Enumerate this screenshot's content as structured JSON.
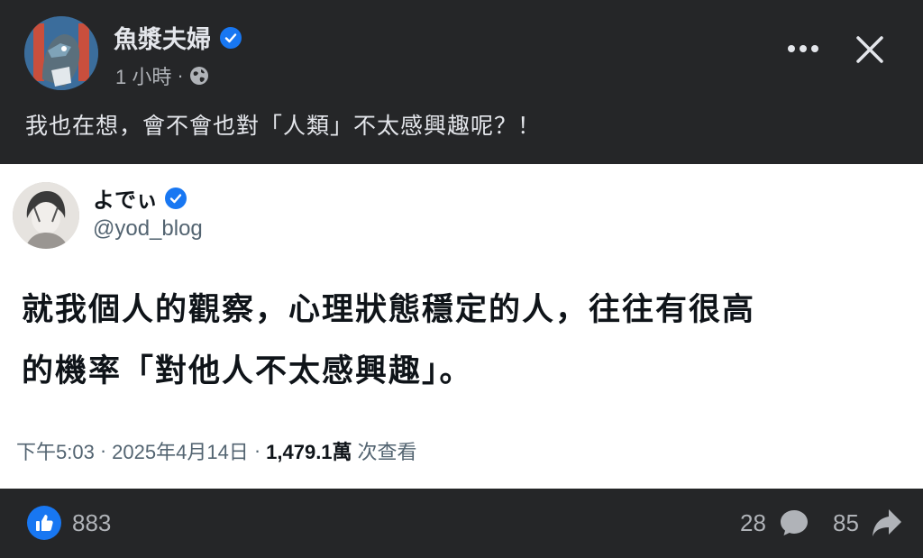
{
  "post": {
    "author": "魚漿夫婦",
    "time": "1 小時",
    "separator": "·",
    "text": "我也在想，會不會也對「人類」不太感興趣呢？！"
  },
  "tweet": {
    "name": "よでぃ",
    "handle": "@yod_blog",
    "body_line1": "就我個人的觀察，心理狀態穩定的人，往往有很高",
    "body_line2": "的機率「對他人不太感興趣」。",
    "time": "下午5:03",
    "dot1": "·",
    "date": "2025年4月14日",
    "dot2": "·",
    "views": "1,479.1萬",
    "views_label": "次查看"
  },
  "reactions": {
    "likes": "883",
    "comments": "28",
    "shares": "85"
  },
  "colors": {
    "background": "#252628",
    "accent": "#1877f2",
    "tweet_bg": "#ffffff"
  },
  "icons": [
    "verified-badge-icon",
    "globe-icon",
    "more-options-icon",
    "close-icon",
    "like-icon",
    "comment-icon",
    "share-icon"
  ]
}
